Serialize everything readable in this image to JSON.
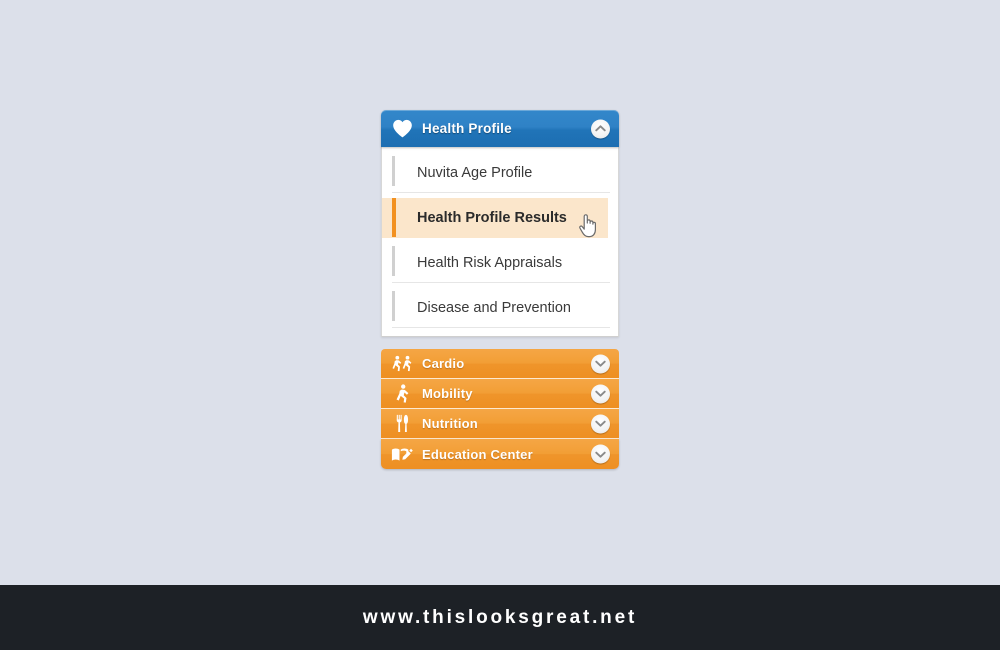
{
  "page": {
    "background_color": "#dce0ea"
  },
  "accordion": {
    "header": {
      "title": "Health Profile",
      "icon": "heart-icon",
      "toggle_icon": "chevron-up-icon",
      "expanded": true,
      "background_color": "#2a7dc2"
    },
    "menu_items": [
      {
        "label": "Nuvita Age Profile",
        "active": false
      },
      {
        "label": "Health Profile Results",
        "active": true
      },
      {
        "label": "Health Risk Appraisals",
        "active": false
      },
      {
        "label": "Disease and Prevention",
        "active": false
      }
    ],
    "active_item_colors": {
      "background": "#fbe6cb",
      "accent_bar": "#f29120"
    },
    "sections": [
      {
        "label": "Cardio",
        "icon": "running-figures-icon",
        "toggle_icon": "chevron-down-icon"
      },
      {
        "label": "Mobility",
        "icon": "walking-figure-icon",
        "toggle_icon": "chevron-down-icon"
      },
      {
        "label": "Nutrition",
        "icon": "fork-knife-icon",
        "toggle_icon": "chevron-down-icon"
      },
      {
        "label": "Education Center",
        "icon": "book-pencil-icon",
        "toggle_icon": "chevron-down-icon"
      }
    ],
    "section_color": "#f09a2c"
  },
  "cursor": {
    "type": "pointing-hand-cursor"
  },
  "footer": {
    "site": "www.thislooksgreat.net",
    "background_color": "#1d2126"
  }
}
